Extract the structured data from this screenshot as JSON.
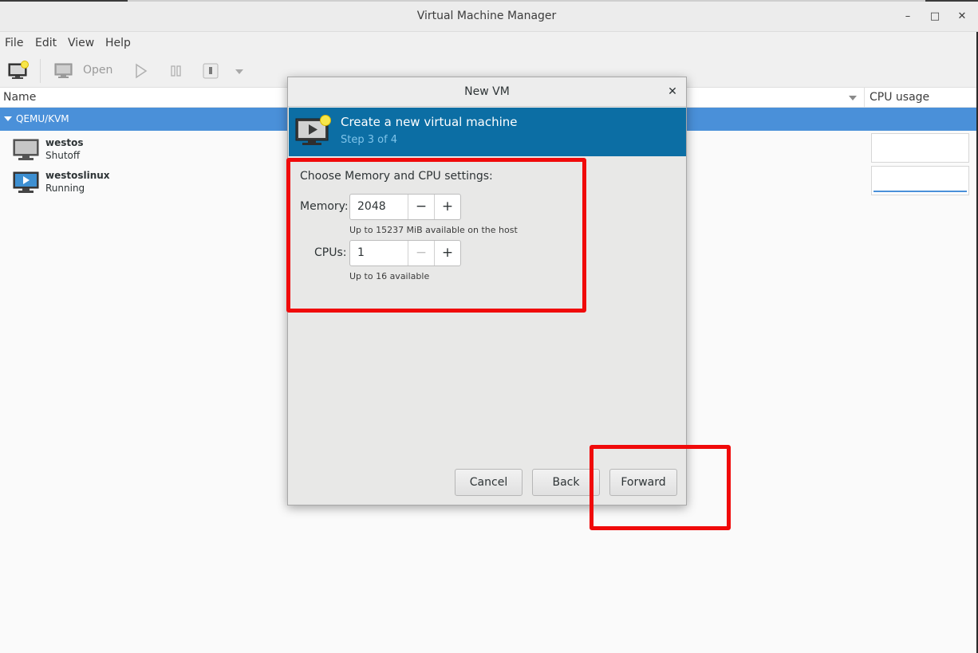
{
  "window": {
    "title": "Virtual Machine Manager",
    "minimize": "–",
    "maximize": "□",
    "close": "✕"
  },
  "menu": [
    "File",
    "Edit",
    "View",
    "Help"
  ],
  "toolbar": {
    "open_label": "Open"
  },
  "list": {
    "col_name": "Name",
    "col_cpu": "CPU usage",
    "group": "QEMU/KVM",
    "vms": [
      {
        "name": "westos",
        "status": "Shutoff"
      },
      {
        "name": "westoslinux",
        "status": "Running"
      }
    ],
    "cpu_levels": [
      0,
      0.08
    ]
  },
  "dialog": {
    "title": "New VM",
    "close": "✕",
    "banner_title": "Create a new virtual machine",
    "banner_step": "Step 3 of 4",
    "heading": "Choose Memory and CPU settings:",
    "memory_label": "Memory:",
    "memory_value": "2048",
    "memory_hint": "Up to 15237 MiB available on the host",
    "cpus_label": "CPUs:",
    "cpus_value": "1",
    "cpus_hint": "Up to 16 available",
    "minus": "−",
    "plus": "+",
    "cancel": "Cancel",
    "back": "Back",
    "forward": "Forward"
  },
  "colors": {
    "banner": "#0c6ea4",
    "selection": "#4a90d9",
    "annotation": "#f00a0a"
  }
}
